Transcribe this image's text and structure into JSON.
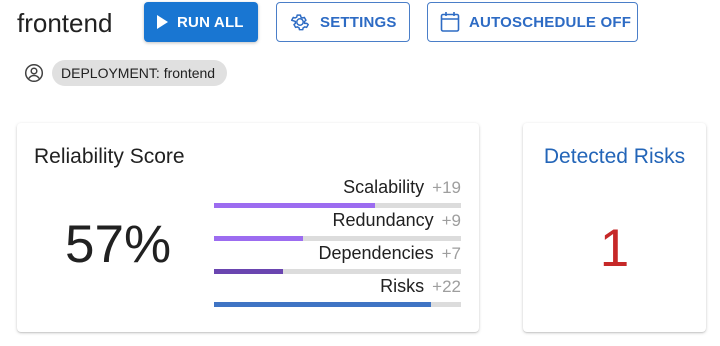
{
  "header": {
    "title": "frontend",
    "buttons": {
      "run_all": "RUN ALL",
      "settings": "SETTINGS",
      "autoschedule": "AUTOSCHEDULE OFF"
    }
  },
  "deployment_chip": {
    "icon": "account-circle-icon",
    "label": "DEPLOYMENT: frontend"
  },
  "reliability": {
    "heading": "Reliability Score",
    "score": "57%",
    "metrics": [
      {
        "name": "Scalability",
        "delta": "+19",
        "fill_fraction": 0.65,
        "color": "#9c6cf0"
      },
      {
        "name": "Redundancy",
        "delta": "+9",
        "fill_fraction": 0.36,
        "color": "#9c6cf0"
      },
      {
        "name": "Dependencies",
        "delta": "+7",
        "fill_fraction": 0.28,
        "color": "#6a45b0"
      },
      {
        "name": "Risks",
        "delta": "+22",
        "fill_fraction": 0.88,
        "color": "#3f74c4"
      }
    ]
  },
  "detected_risks": {
    "heading": "Detected Risks",
    "count": "1"
  },
  "colors": {
    "primary": "#1976d2",
    "outline": "#2d6bc4",
    "risk_count": "#c62828"
  }
}
